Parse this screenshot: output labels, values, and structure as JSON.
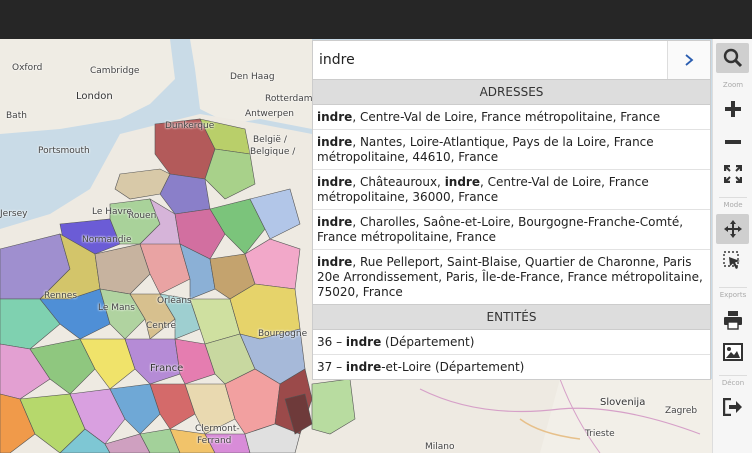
{
  "search": {
    "value": "indre"
  },
  "sections": {
    "addresses_title": "ADRESSES",
    "entities_title": "ENTITÉS"
  },
  "addresses": [
    {
      "parts": [
        {
          "t": "indre",
          "b": true
        },
        {
          "t": ", Centre-Val de Loire, France métropolitaine, France",
          "b": false
        }
      ]
    },
    {
      "parts": [
        {
          "t": "indre",
          "b": true
        },
        {
          "t": ", Nantes, Loire-Atlantique, Pays de la Loire, France métropolitaine, 44610, France",
          "b": false
        }
      ]
    },
    {
      "parts": [
        {
          "t": "indre",
          "b": true
        },
        {
          "t": ", Châteauroux, ",
          "b": false
        },
        {
          "t": "indre",
          "b": true
        },
        {
          "t": ", Centre-Val de Loire, France métropolitaine, 36000, France",
          "b": false
        }
      ]
    },
    {
      "parts": [
        {
          "t": "indre",
          "b": true
        },
        {
          "t": ", Charolles, Saône-et-Loire, Bourgogne-Franche-Comté, France métropolitaine, France",
          "b": false
        }
      ]
    },
    {
      "parts": [
        {
          "t": "indre",
          "b": true
        },
        {
          "t": ", Rue Pelleport, Saint-Blaise, Quartier de Charonne, Paris 20e Arrondissement, Paris, Île-de-France, France métropolitaine, 75020, France",
          "b": false
        }
      ]
    }
  ],
  "entities": [
    {
      "parts": [
        {
          "t": "36 – ",
          "b": false
        },
        {
          "t": "indre",
          "b": true
        },
        {
          "t": " (Département)",
          "b": false
        }
      ]
    },
    {
      "parts": [
        {
          "t": "37 – ",
          "b": false
        },
        {
          "t": "indre",
          "b": true
        },
        {
          "t": "-et-Loire (Département)",
          "b": false
        }
      ]
    }
  ],
  "toolbar": {
    "zoom_label": "Zoom",
    "mode_label": "Mode",
    "exports_label": "Exports",
    "deconnexion_label": "Décon"
  },
  "map_labels": {
    "oxford": "Oxford",
    "cambridge": "Cambridge",
    "london": "London",
    "denhaag": "Den Haag",
    "rotterdam": "Rotterdam",
    "bath": "Bath",
    "portsmouth": "Portsmouth",
    "antwerpen": "Antwerpen",
    "dunkerque": "Dunkerque",
    "belgie": "België /",
    "belgique": "Belgique /",
    "jersey": "Jersey",
    "rouen": "Rouen",
    "le_havre": "Le Havre",
    "normandie": "Normandie",
    "rennes": "Rennes",
    "le_mans": "Le Mans",
    "orleans": "Orléans",
    "centre": "Centre",
    "france": "France",
    "clermont": "Clermont-",
    "ferrand": "Ferrand",
    "bourgogne": "Bourgogne",
    "slovenija": "Slovenija",
    "zagreb": "Zagreb",
    "trieste": "Trieste",
    "milano": "Milano"
  },
  "colors": {
    "accent_active": "#cfcfcf",
    "topbar": "#262626",
    "section_header": "#dddddd"
  }
}
